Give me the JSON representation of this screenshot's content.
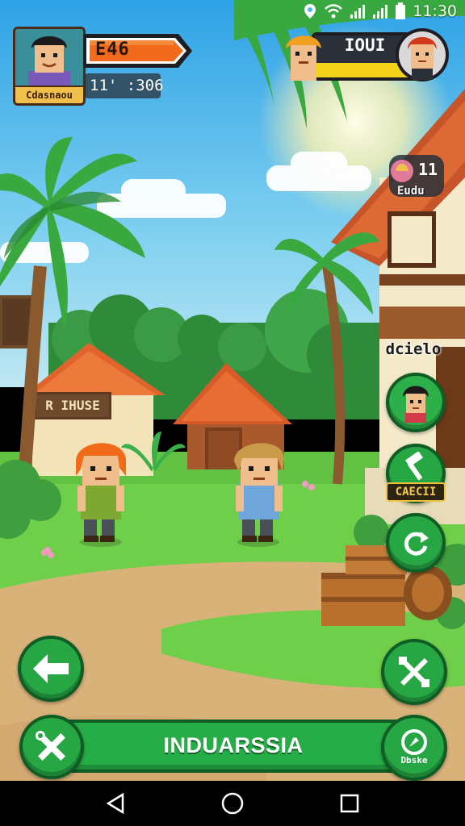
{
  "status_bar": {
    "time": "11:30",
    "icons": [
      "location-icon",
      "wifi-icon",
      "signal-icon",
      "signal-icon",
      "battery-icon"
    ]
  },
  "player": {
    "name": "Cdasnaou",
    "score": "E46",
    "timer": "11' :306"
  },
  "opponent": {
    "label": "IOUI"
  },
  "level_badge": {
    "number": "11",
    "text": "Eudu"
  },
  "sidebar": {
    "header": "dcielo",
    "craft_label": "CAECII"
  },
  "scene": {
    "house_sign": "R IHUSE"
  },
  "bottom_bar": {
    "location_name": "INDUARSSIA",
    "profile_label": "Dbske"
  },
  "nav_bar": {
    "icons": [
      "back-triangle-icon",
      "home-circle-icon",
      "recents-square-icon"
    ]
  },
  "colors": {
    "button_green": "#26a744",
    "button_border": "#0f5c24",
    "score_orange": "#f26a1b",
    "opponent_yellow": "#f3d21a",
    "sky": "#4cb8ea",
    "grass": "#6fcf4a",
    "path": "#d9b27a"
  }
}
